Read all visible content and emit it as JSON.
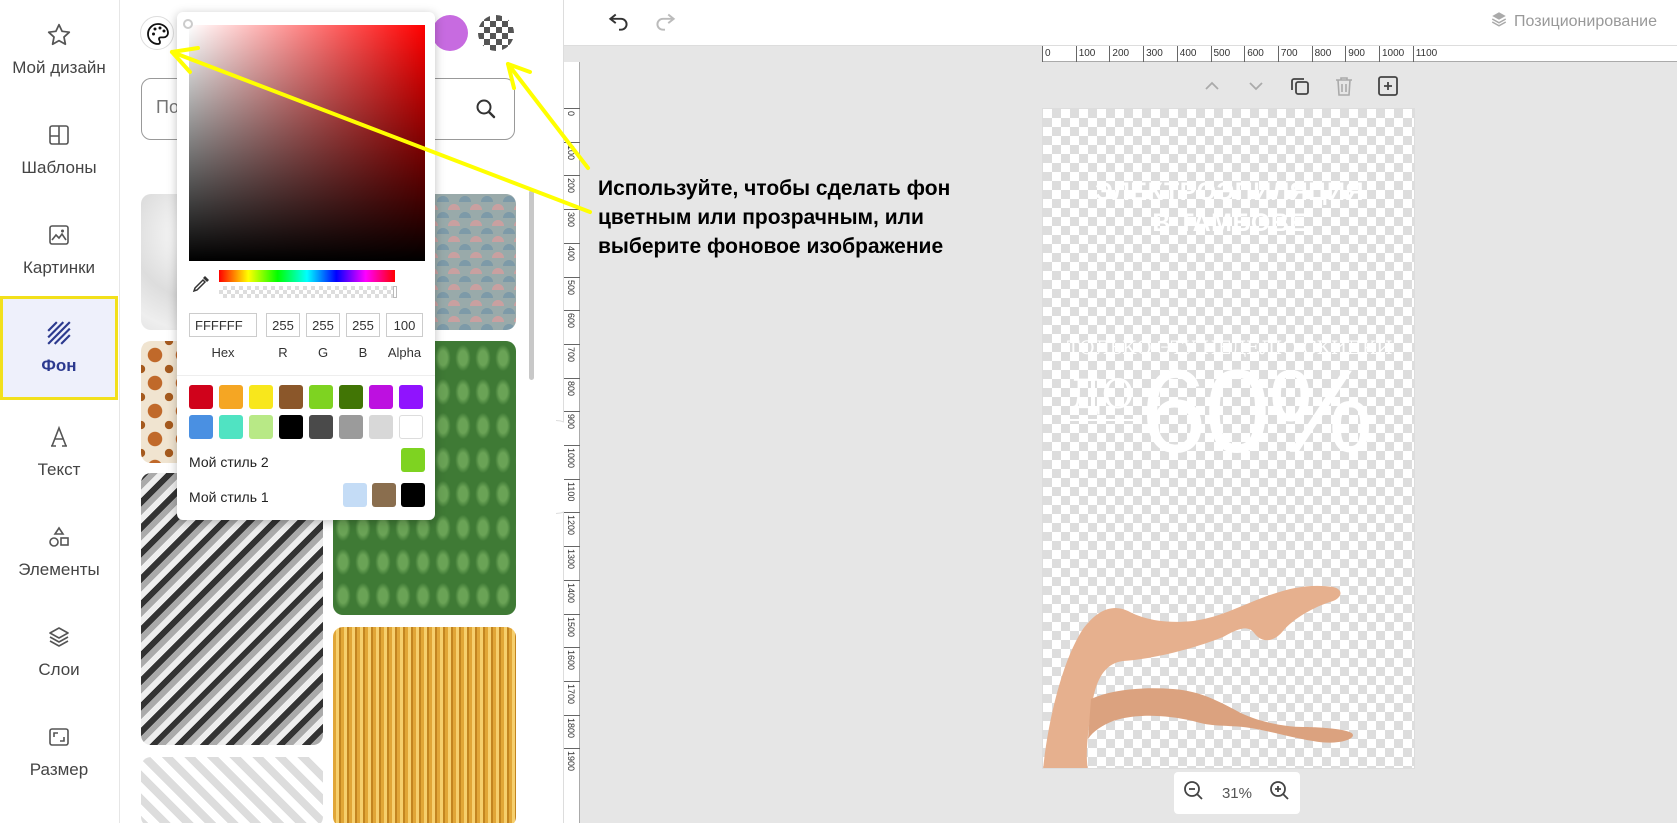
{
  "nav": {
    "items": [
      {
        "label": "Мой дизайн",
        "icon": "star-icon"
      },
      {
        "label": "Шаблоны",
        "icon": "template-icon"
      },
      {
        "label": "Картинки",
        "icon": "image-icon"
      },
      {
        "label": "Фон",
        "icon": "background-icon",
        "active": true
      },
      {
        "label": "Текст",
        "icon": "text-icon"
      },
      {
        "label": "Элементы",
        "icon": "elements-icon"
      },
      {
        "label": "Слои",
        "icon": "layers-icon"
      },
      {
        "label": "Размер",
        "icon": "resize-icon"
      }
    ],
    "highlight_color": "#f2e01b"
  },
  "panel": {
    "search": {
      "placeholder": "По"
    }
  },
  "picker": {
    "hex": "FFFFFF",
    "r": "255",
    "g": "255",
    "b": "255",
    "alpha": "100",
    "labels": {
      "hex": "Hex",
      "r": "R",
      "g": "G",
      "b": "B",
      "alpha": "Alpha"
    },
    "swatches": [
      "#d0021b",
      "#f5a623",
      "#f8e71c",
      "#8b572a",
      "#7ed321",
      "#417505",
      "#bd10e0",
      "#9013fe",
      "#4a90e2",
      "#50e3c2",
      "#b8e986",
      "#000000",
      "#4a4a4a",
      "#9b9b9b",
      "#d8d8d8",
      "#ffffff"
    ],
    "styles": [
      {
        "label": "Мой стиль 2",
        "colors": [
          "#7ed321"
        ]
      },
      {
        "label": "Мой стиль 1",
        "colors": [
          "#c4dcf6",
          "#8a6e4e",
          "#000000"
        ]
      }
    ]
  },
  "workspace": {
    "positioning_label": "Позиционирование",
    "ruler_h": [
      "0",
      "100",
      "200",
      "300",
      "400",
      "500",
      "600",
      "700",
      "800",
      "900",
      "1000",
      "1100"
    ],
    "ruler_v": [
      "0",
      "100",
      "200",
      "300",
      "400",
      "500",
      "600",
      "700",
      "800",
      "900",
      "1000",
      "1100",
      "1200",
      "1300",
      "1400",
      "1500",
      "1600",
      "1700",
      "1800",
      "1900"
    ],
    "zoom_label": "31%"
  },
  "design": {
    "headline_1": "ЭЛЕКТРОЭПИЛЯЦИЯ",
    "headline_2": "В ТАМБОВЕ",
    "subline": "ТОЛЬКО ЭТУ НЕДЕЛЮ СКИДКИ",
    "prefix": "ДО",
    "discount": "60%"
  },
  "annotation": {
    "text_1": "Используйте, чтобы сделать фон",
    "text_2": "цветным или прозрачным, или",
    "text_3": "выберите фоновое изображение",
    "color": "#ffff00"
  }
}
